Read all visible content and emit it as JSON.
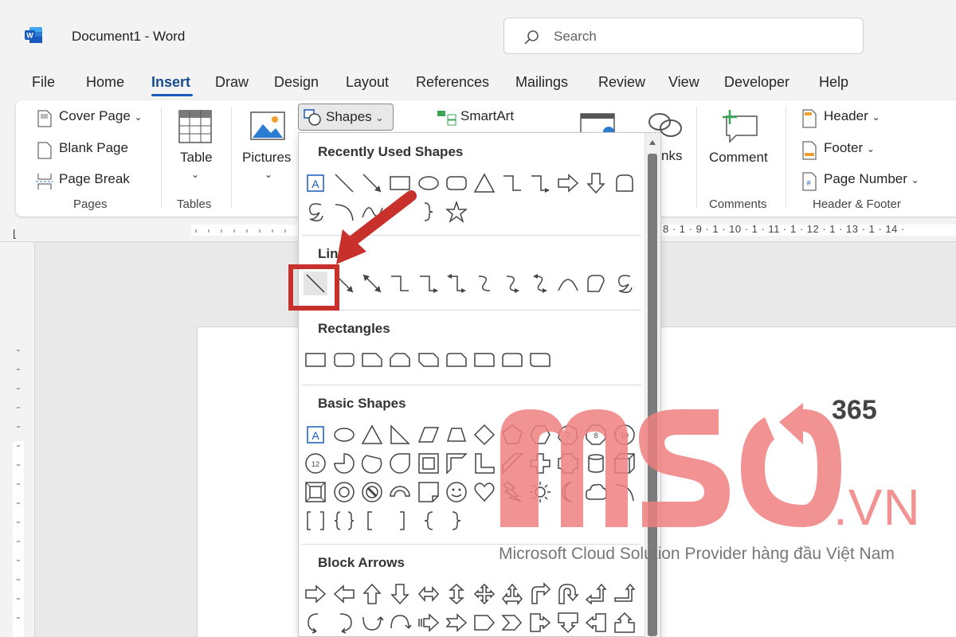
{
  "window": {
    "app_title": "Document1  -  Word"
  },
  "search": {
    "placeholder": "Search"
  },
  "menu": {
    "tabs": [
      {
        "label": "File"
      },
      {
        "label": "Home"
      },
      {
        "label": "Insert"
      },
      {
        "label": "Draw"
      },
      {
        "label": "Design"
      },
      {
        "label": "Layout"
      },
      {
        "label": "References"
      },
      {
        "label": "Mailings"
      },
      {
        "label": "Review"
      },
      {
        "label": "View"
      },
      {
        "label": "Developer"
      },
      {
        "label": "Help"
      }
    ],
    "active": "Insert"
  },
  "ribbon": {
    "pages": {
      "cover": "Cover Page",
      "blank": "Blank Page",
      "break": "Page Break",
      "group": "Pages"
    },
    "tables": {
      "table": "Table",
      "group": "Tables"
    },
    "pictures": {
      "label": "Pictures"
    },
    "shapes": {
      "label": "Shapes"
    },
    "smartart": {
      "label": "SmartArt"
    },
    "links": {
      "label_partial": "nks"
    },
    "comments": {
      "comment": "Comment",
      "group": "Comments"
    },
    "header_footer": {
      "header": "Header",
      "footer": "Footer",
      "page_number": "Page Number",
      "group": "Header & Footer"
    }
  },
  "ruler": {
    "right_numbers": "8 · 1 · 9 · 1 · 10 · 1 · 11 · 1 · 12 · 1 · 13 · 1 · 14 ·"
  },
  "shapes_dropdown": {
    "sections": {
      "recent": "Recently Used Shapes",
      "lines": "Lines",
      "rectangles": "Rectangles",
      "basic": "Basic Shapes",
      "block_arrows": "Block Arrows"
    },
    "selected_shape": "line"
  },
  "watermark": {
    "brand_number": "365",
    "domain_suffix": ".VN",
    "tagline": "Microsoft Cloud Solution Provider hàng đầu Việt Nam",
    "color": "#f08080"
  },
  "colors": {
    "accent": "#185abd",
    "highlight": "#c8302c"
  }
}
